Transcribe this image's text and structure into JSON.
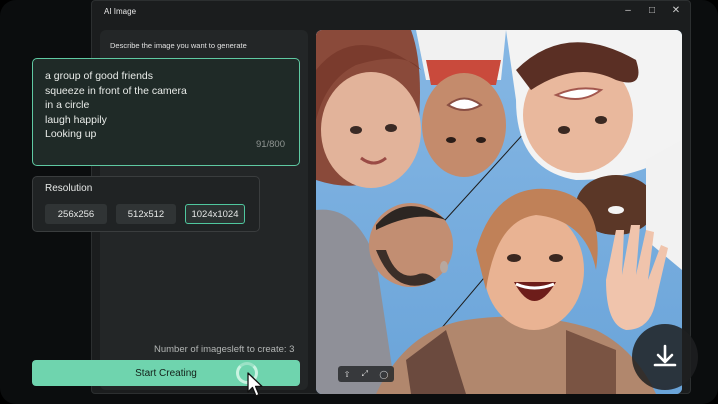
{
  "window": {
    "title": "AI Image",
    "controls": [
      "minimize-icon",
      "maximize-icon",
      "close-icon"
    ]
  },
  "prompt": {
    "label": "Describe the image you want to generate",
    "lines": [
      "a group of good friends",
      "squeeze in front of the camera",
      "in a circle",
      "laugh happily",
      "Looking up"
    ],
    "char_count": "91/800"
  },
  "resolution": {
    "title": "Resolution",
    "options": [
      "256x256",
      "512x512",
      "1024x1024"
    ],
    "selected": "1024x1024"
  },
  "images_left_text": "Number of imagesleft to create: 3",
  "start_button": "Start Creating",
  "image_toolbar_icons": [
    "share-icon",
    "fullscreen-icon",
    "settings-icon"
  ],
  "download_icon": "download-icon",
  "colors": {
    "accent": "#6fd4ae",
    "accent_border": "#5fc9a2",
    "window_bg": "#1b1d1e"
  }
}
